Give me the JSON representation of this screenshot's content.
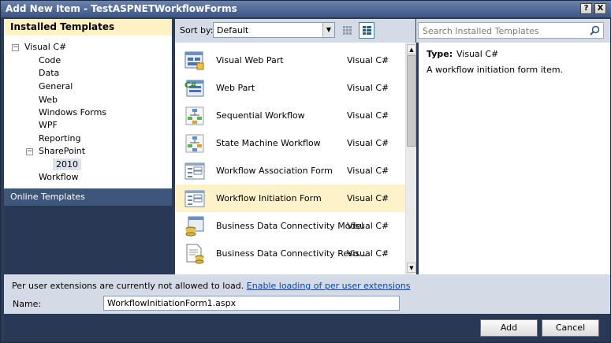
{
  "window": {
    "title": "Add New Item - TestASPNETWorkflowForms",
    "help_glyph": "?",
    "close_glyph": "X"
  },
  "left_panel": {
    "installed_header": "Installed Templates",
    "tree": [
      {
        "label": "Visual C#",
        "expander": "−"
      },
      {
        "label": "Code"
      },
      {
        "label": "Data"
      },
      {
        "label": "General"
      },
      {
        "label": "Web"
      },
      {
        "label": "Windows Forms"
      },
      {
        "label": "WPF"
      },
      {
        "label": "Reporting"
      },
      {
        "label": "SharePoint",
        "expander": "−"
      },
      {
        "label": "2010"
      },
      {
        "label": "Workflow"
      }
    ],
    "online_templates": "Online Templates"
  },
  "toolbar": {
    "sort_label": "Sort by:",
    "sort_value": "Default",
    "sort_arrow": "▼"
  },
  "templates": [
    {
      "name": "Visual Web Part",
      "lang": "Visual C#",
      "icon": "visual-web-part-icon"
    },
    {
      "name": "Web Part",
      "lang": "Visual C#",
      "icon": "web-part-icon"
    },
    {
      "name": "Sequential Workflow",
      "lang": "Visual C#",
      "icon": "sequential-workflow-icon"
    },
    {
      "name": "State Machine Workflow",
      "lang": "Visual C#",
      "icon": "state-machine-workflow-icon"
    },
    {
      "name": "Workflow Association Form",
      "lang": "Visual C#",
      "icon": "form-icon"
    },
    {
      "name": "Workflow Initiation Form",
      "lang": "Visual C#",
      "icon": "form-icon",
      "selected": true
    },
    {
      "name": "Business Data Connectivity Model",
      "lang": "Visual C#",
      "icon": "bdc-model-icon"
    },
    {
      "name": "Business Data Connectivity Reso...",
      "lang": "Visual C#",
      "icon": "bdc-resource-icon"
    }
  ],
  "scrollbar": {
    "up": "▲",
    "down": "▼"
  },
  "search": {
    "placeholder": "Search Installed Templates"
  },
  "details": {
    "type_label": "Type:",
    "type_value": "Visual C#",
    "description": "A workflow initiation form item."
  },
  "bottom": {
    "ext_message": "Per user extensions are currently not allowed to load.",
    "ext_link": "Enable loading of per user extensions",
    "name_label": "Name:",
    "name_value": "WorkflowInitiationForm1.aspx",
    "add_label": "Add",
    "cancel_label": "Cancel"
  },
  "colors": {
    "frame": "#293955",
    "selection": "#fdf2c9",
    "header": "#fff1c4",
    "online": "#3e5679"
  }
}
